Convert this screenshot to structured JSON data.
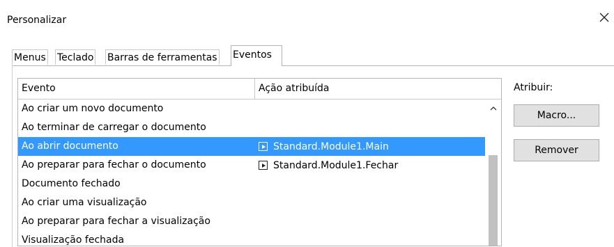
{
  "dialog": {
    "title": "Personalizar"
  },
  "tabs": [
    {
      "label": "Menus"
    },
    {
      "label": "Teclado"
    },
    {
      "label": "Barras de ferramentas"
    },
    {
      "label": "Eventos"
    }
  ],
  "events_table": {
    "columns": [
      "Evento",
      "Ação atribuída"
    ],
    "rows": [
      {
        "event": "Ao criar um novo documento",
        "action": ""
      },
      {
        "event": "Ao terminar de carregar o documento",
        "action": ""
      },
      {
        "event": "Ao abrir documento",
        "action": "Standard.Module1.Main",
        "selected": true
      },
      {
        "event": "Ao preparar para fechar o documento",
        "action": "Standard.Module1.Fechar"
      },
      {
        "event": "Documento fechado",
        "action": ""
      },
      {
        "event": "Ao criar uma visualização",
        "action": ""
      },
      {
        "event": "Ao preparar para fechar a visualização",
        "action": ""
      },
      {
        "event": "Visualização fechada",
        "action": ""
      }
    ]
  },
  "assign": {
    "label": "Atribuir:",
    "macro_button": "Macro...",
    "remove_button": "Remover"
  },
  "colors": {
    "selection": "#3399ff"
  }
}
